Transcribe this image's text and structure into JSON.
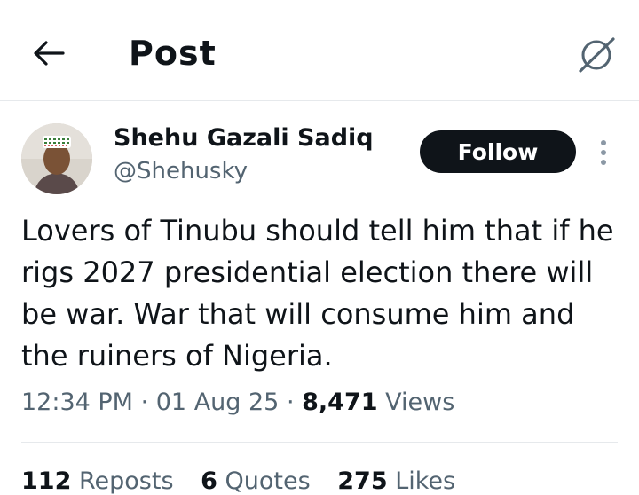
{
  "header": {
    "title": "Post"
  },
  "icons": {
    "back": "arrow-left-icon",
    "grok": "grok-icon",
    "more": "more-vertical-icon"
  },
  "author": {
    "name": "Shehu Gazali Sadiq",
    "handle": "@Shehusky"
  },
  "follow_label": "Follow",
  "tweet": {
    "text": "Lovers of Tinubu should tell him that if he rigs 2027 presidential election there will be war. War that will consume him and the ruiners of Nigeria.",
    "time": "12:34 PM",
    "date": "01 Aug 25",
    "views_count": "8,471",
    "views_label": "Views"
  },
  "stats": {
    "reposts": {
      "count": "112",
      "label": "Reposts"
    },
    "quotes": {
      "count": "6",
      "label": "Quotes"
    },
    "likes": {
      "count": "275",
      "label": "Likes"
    }
  },
  "colors": {
    "primary_text": "#0f1419",
    "secondary_text": "#536471",
    "button_bg": "#0f1419"
  }
}
